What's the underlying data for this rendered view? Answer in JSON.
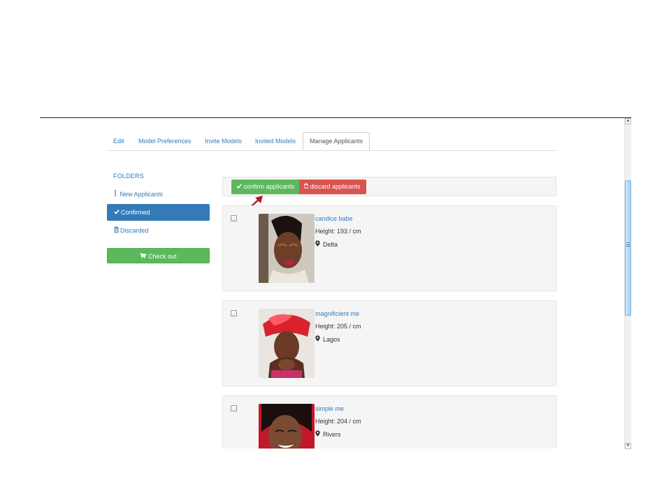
{
  "tabs": [
    {
      "label": "Edit"
    },
    {
      "label": "Model Preferences"
    },
    {
      "label": "Invite Models"
    },
    {
      "label": "Invited Models"
    },
    {
      "label": "Manage Applicants",
      "active": true
    }
  ],
  "sidebar": {
    "title": "FOLDERS",
    "items": [
      {
        "label": "New Applicants",
        "icon": "vertical-dots-icon"
      },
      {
        "label": "Confirmed",
        "icon": "check-icon",
        "active": true
      },
      {
        "label": "Discarded",
        "icon": "trash-icon"
      }
    ],
    "checkout_label": "Check out",
    "checkout_icon": "cart-icon"
  },
  "toolbar": {
    "confirm_label": "confirm applicants",
    "discard_label": "discard applicants"
  },
  "applicants": [
    {
      "name": "candice babe",
      "height": "Height: 193 / cm",
      "location": "Delta"
    },
    {
      "name": "magnificient me",
      "height": "Height: 205 / cm",
      "location": "Lagos"
    },
    {
      "name": "simple me",
      "height": "Height: 204 / cm",
      "location": "Rivers"
    }
  ],
  "colors": {
    "link": "#337ab7",
    "success": "#5cb85c",
    "danger": "#d9534f",
    "annotation_arrow": "#b01c1c"
  }
}
